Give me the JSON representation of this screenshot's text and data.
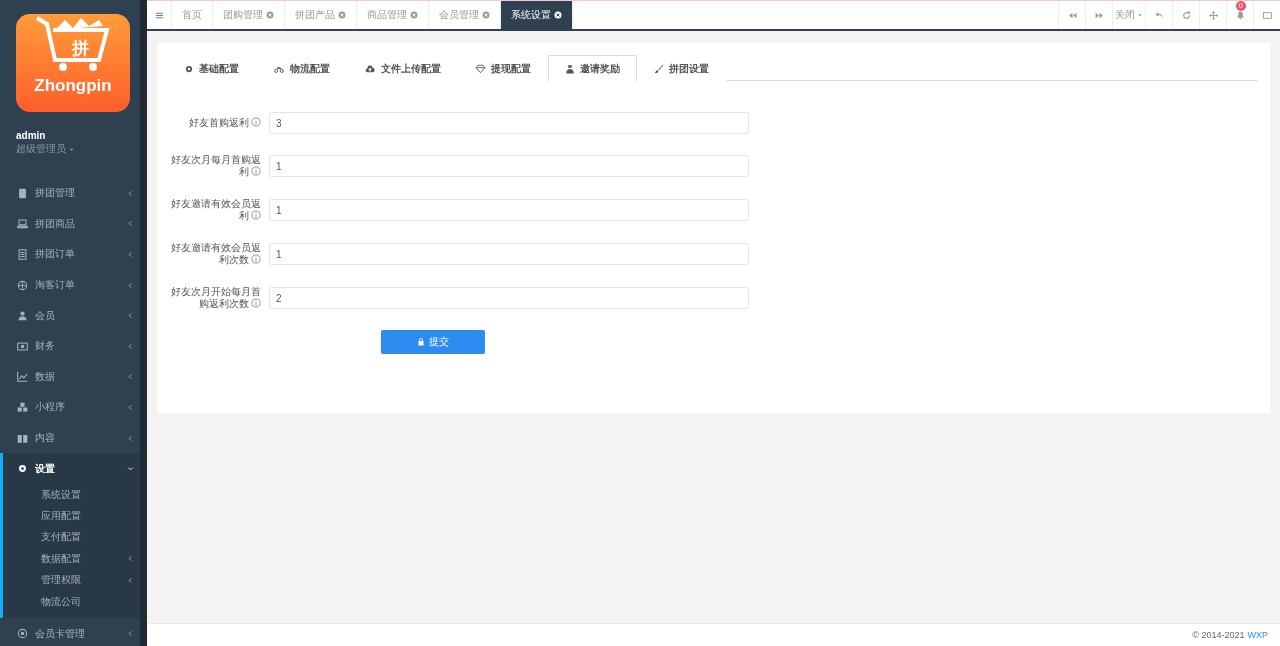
{
  "sidebar": {
    "logo": {
      "name": "Zhongpin",
      "badge": "拼"
    },
    "user": {
      "name": "admin",
      "role": "超级管理员"
    },
    "menu": [
      {
        "label": "拼团管理",
        "selected": false,
        "expanded": false
      },
      {
        "label": "拼团商品",
        "selected": false,
        "expanded": false
      },
      {
        "label": "拼团订单",
        "selected": false,
        "expanded": false
      },
      {
        "label": "淘客订单",
        "selected": false,
        "expanded": false
      },
      {
        "label": "会员",
        "selected": false,
        "expanded": false
      },
      {
        "label": "财务",
        "selected": false,
        "expanded": false
      },
      {
        "label": "数据",
        "selected": false,
        "expanded": false
      },
      {
        "label": "小程序",
        "selected": false,
        "expanded": false
      },
      {
        "label": "内容",
        "selected": false,
        "expanded": false
      },
      {
        "label": "设置",
        "selected": true,
        "expanded": true,
        "children": [
          {
            "label": "系统设置",
            "has_submenu": false
          },
          {
            "label": "应用配置",
            "has_submenu": false
          },
          {
            "label": "支付配置",
            "has_submenu": false
          },
          {
            "label": "数据配置",
            "has_submenu": true
          },
          {
            "label": "管理权限",
            "has_submenu": true
          },
          {
            "label": "物流公司",
            "has_submenu": false
          }
        ]
      },
      {
        "label": "会员卡管理",
        "selected": false,
        "expanded": false
      }
    ]
  },
  "page_tabs": [
    {
      "label": "首页",
      "closable": false,
      "selected": false
    },
    {
      "label": "团购管理",
      "closable": true,
      "selected": false
    },
    {
      "label": "拼团产品",
      "closable": true,
      "selected": false
    },
    {
      "label": "商品管理",
      "closable": true,
      "selected": false
    },
    {
      "label": "会员管理",
      "closable": true,
      "selected": false
    },
    {
      "label": "系统设置",
      "closable": true,
      "selected": true
    }
  ],
  "toolbar": {
    "close_menu": "关闭",
    "notifications": "0"
  },
  "settings_tabs": [
    {
      "label": "基础配置",
      "selected": false
    },
    {
      "label": "物流配置",
      "selected": false
    },
    {
      "label": "文件上传配置",
      "selected": false
    },
    {
      "label": "提现配置",
      "selected": false
    },
    {
      "label": "邀请奖励",
      "selected": true
    },
    {
      "label": "拼团设置",
      "selected": false
    }
  ],
  "form": {
    "fields": [
      {
        "label": "好友首购返利",
        "value": "3"
      },
      {
        "label": "好友次月每月首购返利",
        "value": "1"
      },
      {
        "label": "好友邀请有效会员返利",
        "value": "1"
      },
      {
        "label": "好友邀请有效会员返利次数",
        "value": "1"
      },
      {
        "label": "好友次月开始每月首购返利次数",
        "value": "2"
      }
    ],
    "submit": "提交"
  },
  "footer": {
    "copyright": "© 2014-2021",
    "link": "WXP"
  }
}
